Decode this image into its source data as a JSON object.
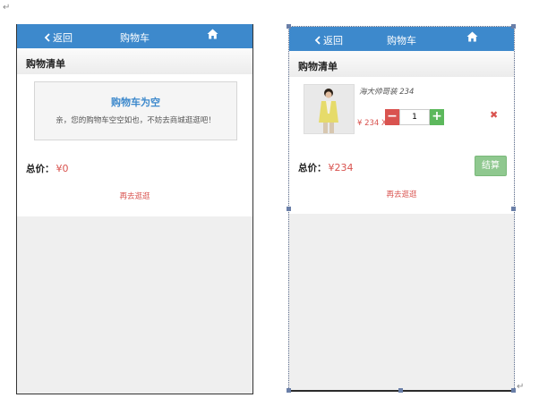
{
  "doc_marks": {
    "top": "↵",
    "bottom": "↵"
  },
  "left_screen": {
    "header": {
      "back_label": "返回",
      "title": "购物车"
    },
    "section_title": "购物清单",
    "empty": {
      "title": "购物车为空",
      "description": "亲，您的购物车空空如也，不妨去商城逛逛吧！"
    },
    "total_label": "总价：",
    "total_value": "¥0",
    "shop_again": "再去逛逛"
  },
  "right_screen": {
    "header": {
      "back_label": "返回",
      "title": "购物车"
    },
    "section_title": "购物清单",
    "item": {
      "name": "海大帅哥装 234",
      "price_label": "¥ 234 X",
      "quantity": "1",
      "minus_label": "−",
      "plus_label": "+",
      "remove_label": "✖"
    },
    "total_label": "总价：",
    "total_value": "¥234",
    "checkout_label": "结算",
    "shop_again": "再去逛逛"
  },
  "colors": {
    "header": "#3d89cc",
    "accent_red": "#d9534f",
    "accent_green": "#5cb85c",
    "checkout": "#8fc88f"
  },
  "icons": {
    "back": "chevron-left-icon",
    "home": "home-icon",
    "remove": "close-icon"
  }
}
